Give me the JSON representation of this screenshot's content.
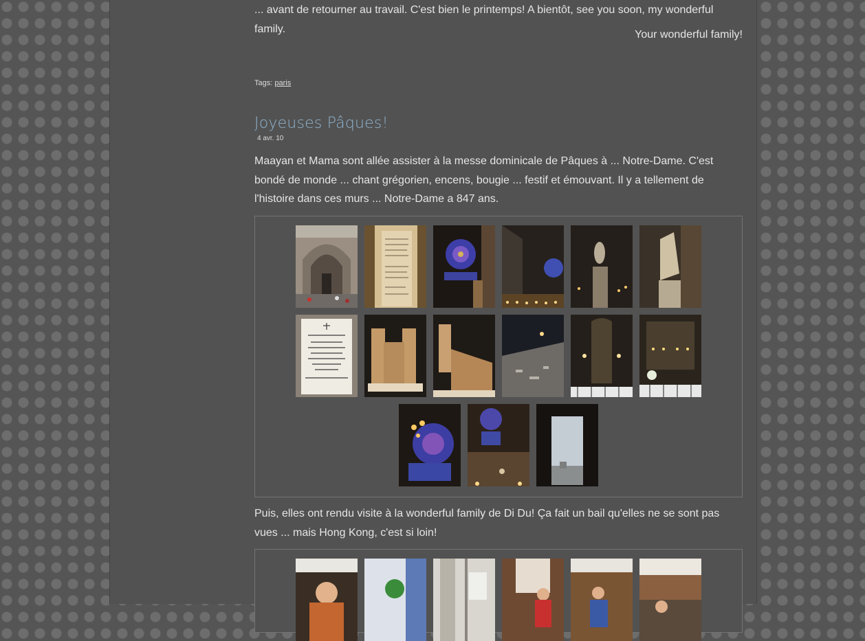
{
  "post_prev": {
    "intro_text": "... avant de retourner au travail. C'est bien le printemps! A bientôt, see you soon, my wonderful family.",
    "signoff": "Your wonderful family!",
    "tags_label": "Tags:",
    "tag": "paris"
  },
  "post": {
    "title": "Joyeuses Pâques!",
    "date": "4 avr. 10",
    "paragraph1": "Maayan et Mama sont allée assister à la messe dominicale de Pâques à ... Notre-Dame. C'est bondé de monde ... chant grégorien, encens, bougie ... festif et émouvant. Il y a tellement de l'histoire dans ces murs ... Notre-Dame a 847 ans.",
    "paragraph2": "Puis, elles ont rendu visite à la wonderful family de Di Du! Ça fait un bail qu'elles ne se sont pas vues ... mais Hong Kong, c'est si loin!"
  },
  "colors": {
    "title": "#8fb4cf",
    "text": "#e6e6e6",
    "page_bg": "#525252"
  }
}
